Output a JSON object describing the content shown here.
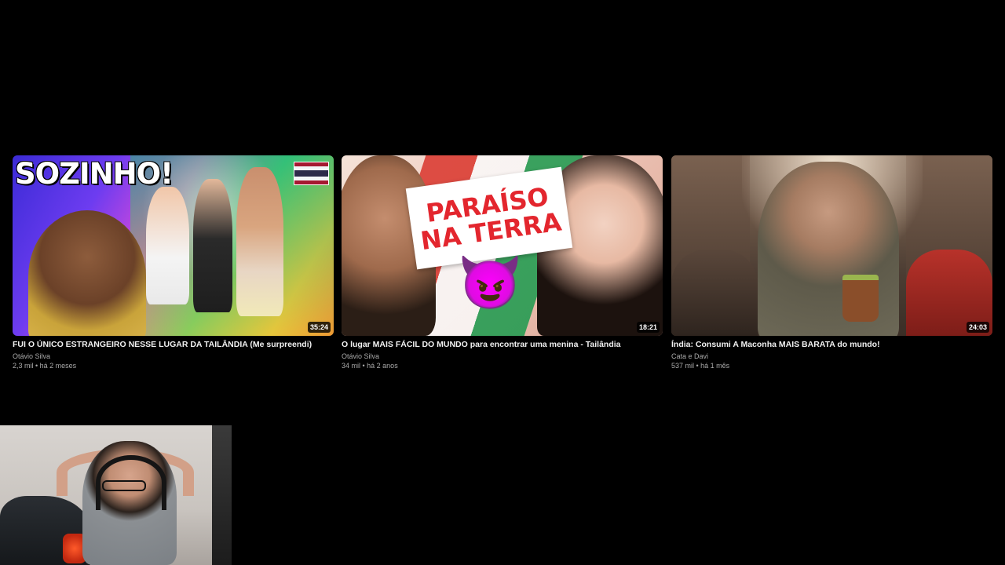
{
  "videos": [
    {
      "title": "FUI O ÚNICO ESTRANGEIRO NESSE LUGAR DA TAILÂNDIA (Me surpreendi)",
      "channel": "Otávio Silva",
      "stats": "2,3 mil • há 2 meses",
      "duration": "35:24",
      "thumb_text": "SOZINHO!"
    },
    {
      "title": "O lugar MAIS FÁCIL DO MUNDO para encontrar uma menina - Tailândia",
      "channel": "Otávio Silva",
      "stats": "34 mil • há 2 anos",
      "duration": "18:21",
      "thumb_text": "PARAÍSO\nNA TERRA",
      "thumb_emoji": "😈"
    },
    {
      "title": "Índia: Consumi A Maconha MAIS BARATA do mundo!",
      "channel": "Cata e Davi",
      "stats": "537 mil • há 1 mês",
      "duration": "24:03"
    }
  ],
  "colors": {
    "background": "#000000",
    "title": "#f1f1f1",
    "meta": "#aaaaaa",
    "thai_flag_red": "#a51931",
    "thai_flag_white": "#f4f5f8",
    "thai_flag_blue": "#2d2a4a"
  }
}
